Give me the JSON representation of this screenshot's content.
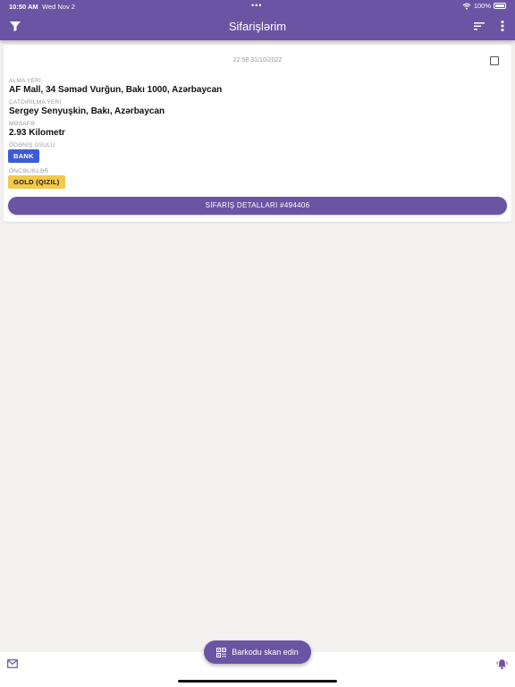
{
  "status_bar": {
    "time": "10:50 AM",
    "date": "Wed Nov 2",
    "dots": "•••",
    "battery": "100%"
  },
  "header": {
    "title": "Sifarişlərim",
    "icons": [
      "filter-icon",
      "sort-icon",
      "more-vert-icon"
    ]
  },
  "order": {
    "datetime": "22:58 31/10/2022",
    "pickup_label": "ALMA YERİ",
    "pickup_value": "AF Mall, 34 Səməd Vurğun, Bakı 1000, Azərbaycan",
    "delivery_label": "ÇATDIRILMA YERİ",
    "delivery_value": "Sergey Senyuşkin, Bakı, Azərbaycan",
    "distance_label": "MƏSAFƏ",
    "distance_value": "2.93 Kilometr",
    "payment_label": "ÖDƏNİŞ ÜSULU",
    "payment_value": "BANK",
    "priority_label": "ÖNCƏLİKLƏR",
    "priority_value": "GOLD (QIZIL)",
    "details_button": "SİFARİŞ DETALLARI #494406"
  },
  "scan_button": {
    "label": "Barkodu skan edin",
    "icon": "qr-code-icon"
  },
  "bottom_bar": {
    "icons": [
      "mail-icon",
      "bell-icon"
    ]
  },
  "colors": {
    "primary": "#6a54a3",
    "bank_badge": "#3d5bd9",
    "gold_badge": "#f2c94c",
    "background": "#f2f1f0"
  }
}
